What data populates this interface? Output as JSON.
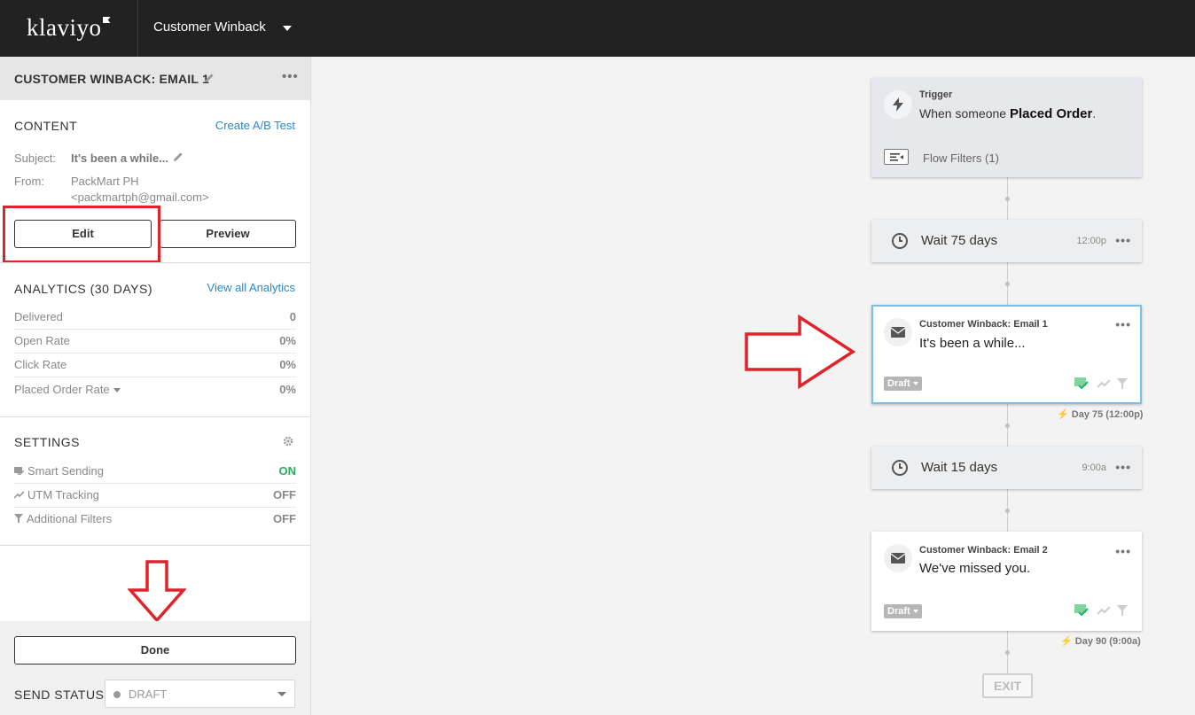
{
  "header": {
    "logo": "klaviyo",
    "flow_name": "Customer Winback"
  },
  "panel": {
    "title": "CUSTOMER WINBACK: EMAIL 1",
    "content": {
      "label": "CONTENT",
      "ab_link": "Create A/B Test",
      "subject_label": "Subject:",
      "subject_value": "It's been a while...",
      "from_label": "From:",
      "from_name": "PackMart PH",
      "from_email": "<packmartph@gmail.com>",
      "edit_btn": "Edit",
      "preview_btn": "Preview"
    },
    "analytics": {
      "label": "ANALYTICS (30 DAYS)",
      "link": "View all Analytics",
      "rows": [
        {
          "label": "Delivered",
          "value": "0"
        },
        {
          "label": "Open Rate",
          "value": "0%"
        },
        {
          "label": "Click Rate",
          "value": "0%"
        },
        {
          "label": "Placed Order Rate",
          "value": "0%"
        }
      ]
    },
    "settings": {
      "label": "SETTINGS",
      "rows": [
        {
          "label": "Smart Sending",
          "value": "ON"
        },
        {
          "label": "UTM Tracking",
          "value": "OFF"
        },
        {
          "label": "Additional Filters",
          "value": "OFF"
        }
      ]
    },
    "done_btn": "Done",
    "send_status_label": "SEND STATUS",
    "send_status_value": "DRAFT"
  },
  "flow": {
    "trigger": {
      "label": "Trigger",
      "prefix": "When someone ",
      "event": "Placed Order",
      "suffix": ".",
      "filters": "Flow Filters (1)"
    },
    "wait1": {
      "label": "Wait 75 days",
      "time": "12:00p"
    },
    "email1": {
      "title": "Customer Winback: Email 1",
      "subject": "It's been a while...",
      "status": "Draft",
      "day": "Day 75 (12:00p)"
    },
    "wait2": {
      "label": "Wait 15 days",
      "time": "9:00a"
    },
    "email2": {
      "title": "Customer Winback: Email 2",
      "subject": "We've missed you.",
      "status": "Draft",
      "day": "Day 90 (9:00a)"
    },
    "exit": "EXIT"
  },
  "colors": {
    "accent_link": "#2b87c9",
    "annotation_red": "#e0232a",
    "on_green": "#27ae60",
    "topbar": "#222222"
  }
}
